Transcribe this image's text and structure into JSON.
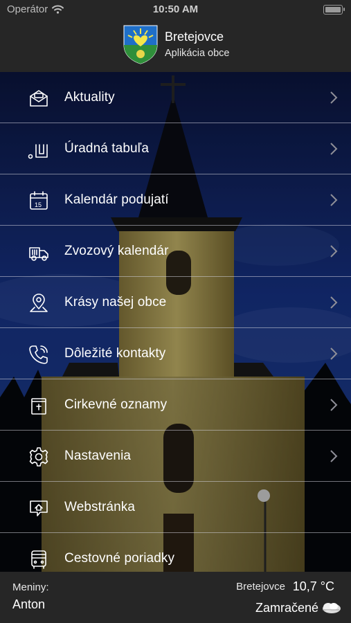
{
  "status_bar": {
    "carrier": "Operátor",
    "time": "10:50 AM"
  },
  "header": {
    "title": "Bretejovce",
    "subtitle": "Aplikácia obce"
  },
  "menu": [
    {
      "label": "Aktuality",
      "icon": "envelope-icon",
      "chevron": true
    },
    {
      "label": "Úradná tabuľa",
      "icon": "notice-board-icon",
      "chevron": true
    },
    {
      "label": "Kalendár podujatí",
      "icon": "calendar-icon",
      "chevron": true
    },
    {
      "label": "Zvozový kalendár",
      "icon": "garbage-truck-icon",
      "chevron": true
    },
    {
      "label": "Krásy našej obce",
      "icon": "map-pin-icon",
      "chevron": true
    },
    {
      "label": "Dôležité kontakty",
      "icon": "phone-icon",
      "chevron": true
    },
    {
      "label": "Cirkevné oznamy",
      "icon": "church-notice-icon",
      "chevron": true
    },
    {
      "label": "Nastavenia",
      "icon": "gear-icon",
      "chevron": true
    },
    {
      "label": "Webstránka",
      "icon": "website-icon",
      "chevron": false
    },
    {
      "label": "Cestovné poriadky",
      "icon": "bus-icon",
      "chevron": false
    }
  ],
  "footer": {
    "name_day_label": "Meniny:",
    "name_day": "Anton",
    "weather_city": "Bretejovce",
    "temperature": "10,7 °C",
    "condition": "Zamračené",
    "weather_icon": "cloud-icon"
  },
  "colors": {
    "bar_bg": "#262626",
    "sky": "#16307a",
    "separator": "#c8c8d0"
  }
}
